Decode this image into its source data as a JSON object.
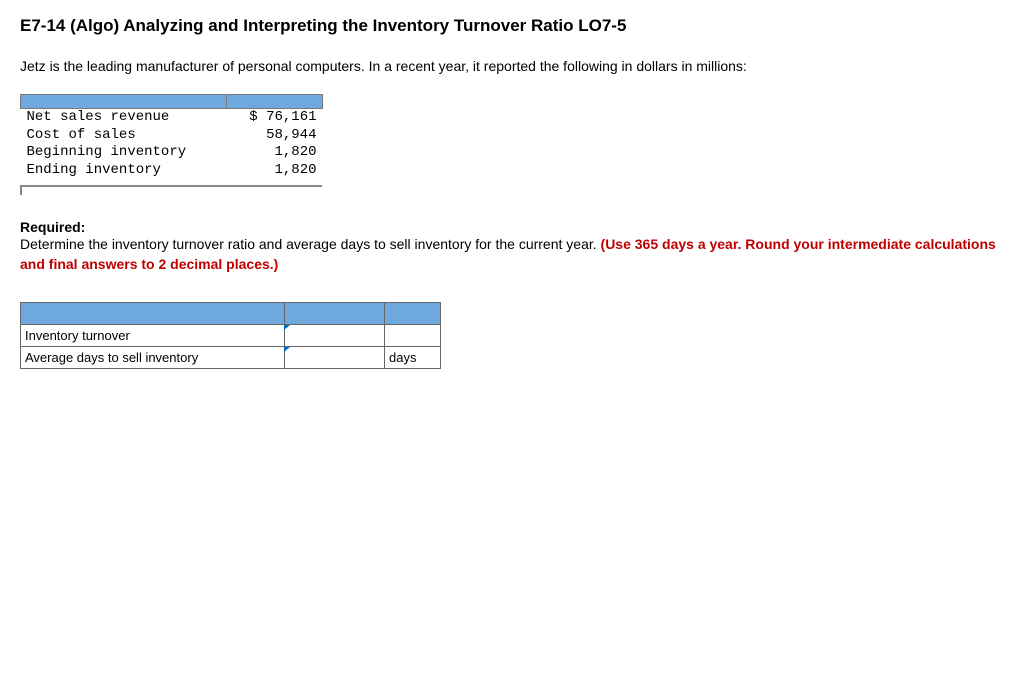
{
  "title": "E7-14 (Algo) Analyzing and Interpreting the Inventory Turnover Ratio LO7-5",
  "description": "Jetz is the leading manufacturer of personal computers. In a recent year, it reported the following in dollars in millions:",
  "financials": {
    "rows": [
      {
        "label": "Net sales revenue",
        "value": "$ 76,161"
      },
      {
        "label": "Cost of sales",
        "value": "58,944"
      },
      {
        "label": "Beginning inventory",
        "value": "1,820"
      },
      {
        "label": "Ending inventory",
        "value": "1,820"
      }
    ]
  },
  "required": {
    "heading": "Required:",
    "text_plain": "Determine the inventory turnover ratio and average days to sell inventory for the current year. ",
    "text_red": "(Use 365 days a year. Round your intermediate calculations and final answers to 2 decimal places.)"
  },
  "answer_table": {
    "rows": [
      {
        "label": "Inventory turnover",
        "unit": ""
      },
      {
        "label": "Average days to sell inventory",
        "unit": "days"
      }
    ]
  }
}
